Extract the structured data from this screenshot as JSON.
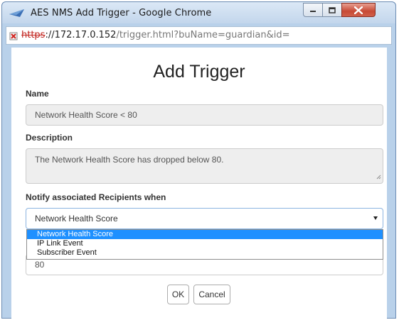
{
  "window": {
    "title": "AES NMS Add Trigger - Google Chrome",
    "controls": {
      "minimize": "minimize",
      "maximize": "maximize",
      "close": "close"
    }
  },
  "address_bar": {
    "scheme": "https",
    "host": "://172.17.0.152",
    "path": "/trigger.html?buName=guardian&id="
  },
  "form": {
    "heading": "Add Trigger",
    "name_label": "Name",
    "name_value": "Network Health Score < 80",
    "description_label": "Description",
    "description_value": "The Network Health Score has dropped below 80.",
    "notify_label": "Notify associated Recipients when",
    "notify_selected": "Network Health Score",
    "notify_options": [
      "Network Health Score",
      "IP Link Event",
      "Subscriber Event"
    ],
    "threshold_value": "80",
    "ok_label": "OK",
    "cancel_label": "Cancel"
  },
  "colors": {
    "titlebar": "#c3d6ec",
    "close_button": "#c74a35",
    "selection": "#1e90ff",
    "scheme_error": "#c0211b"
  },
  "icons": [
    "app-icon",
    "minimize-icon",
    "maximize-icon",
    "close-icon",
    "cert-error-icon",
    "resize-grip-icon",
    "dropdown-arrow-icon"
  ]
}
